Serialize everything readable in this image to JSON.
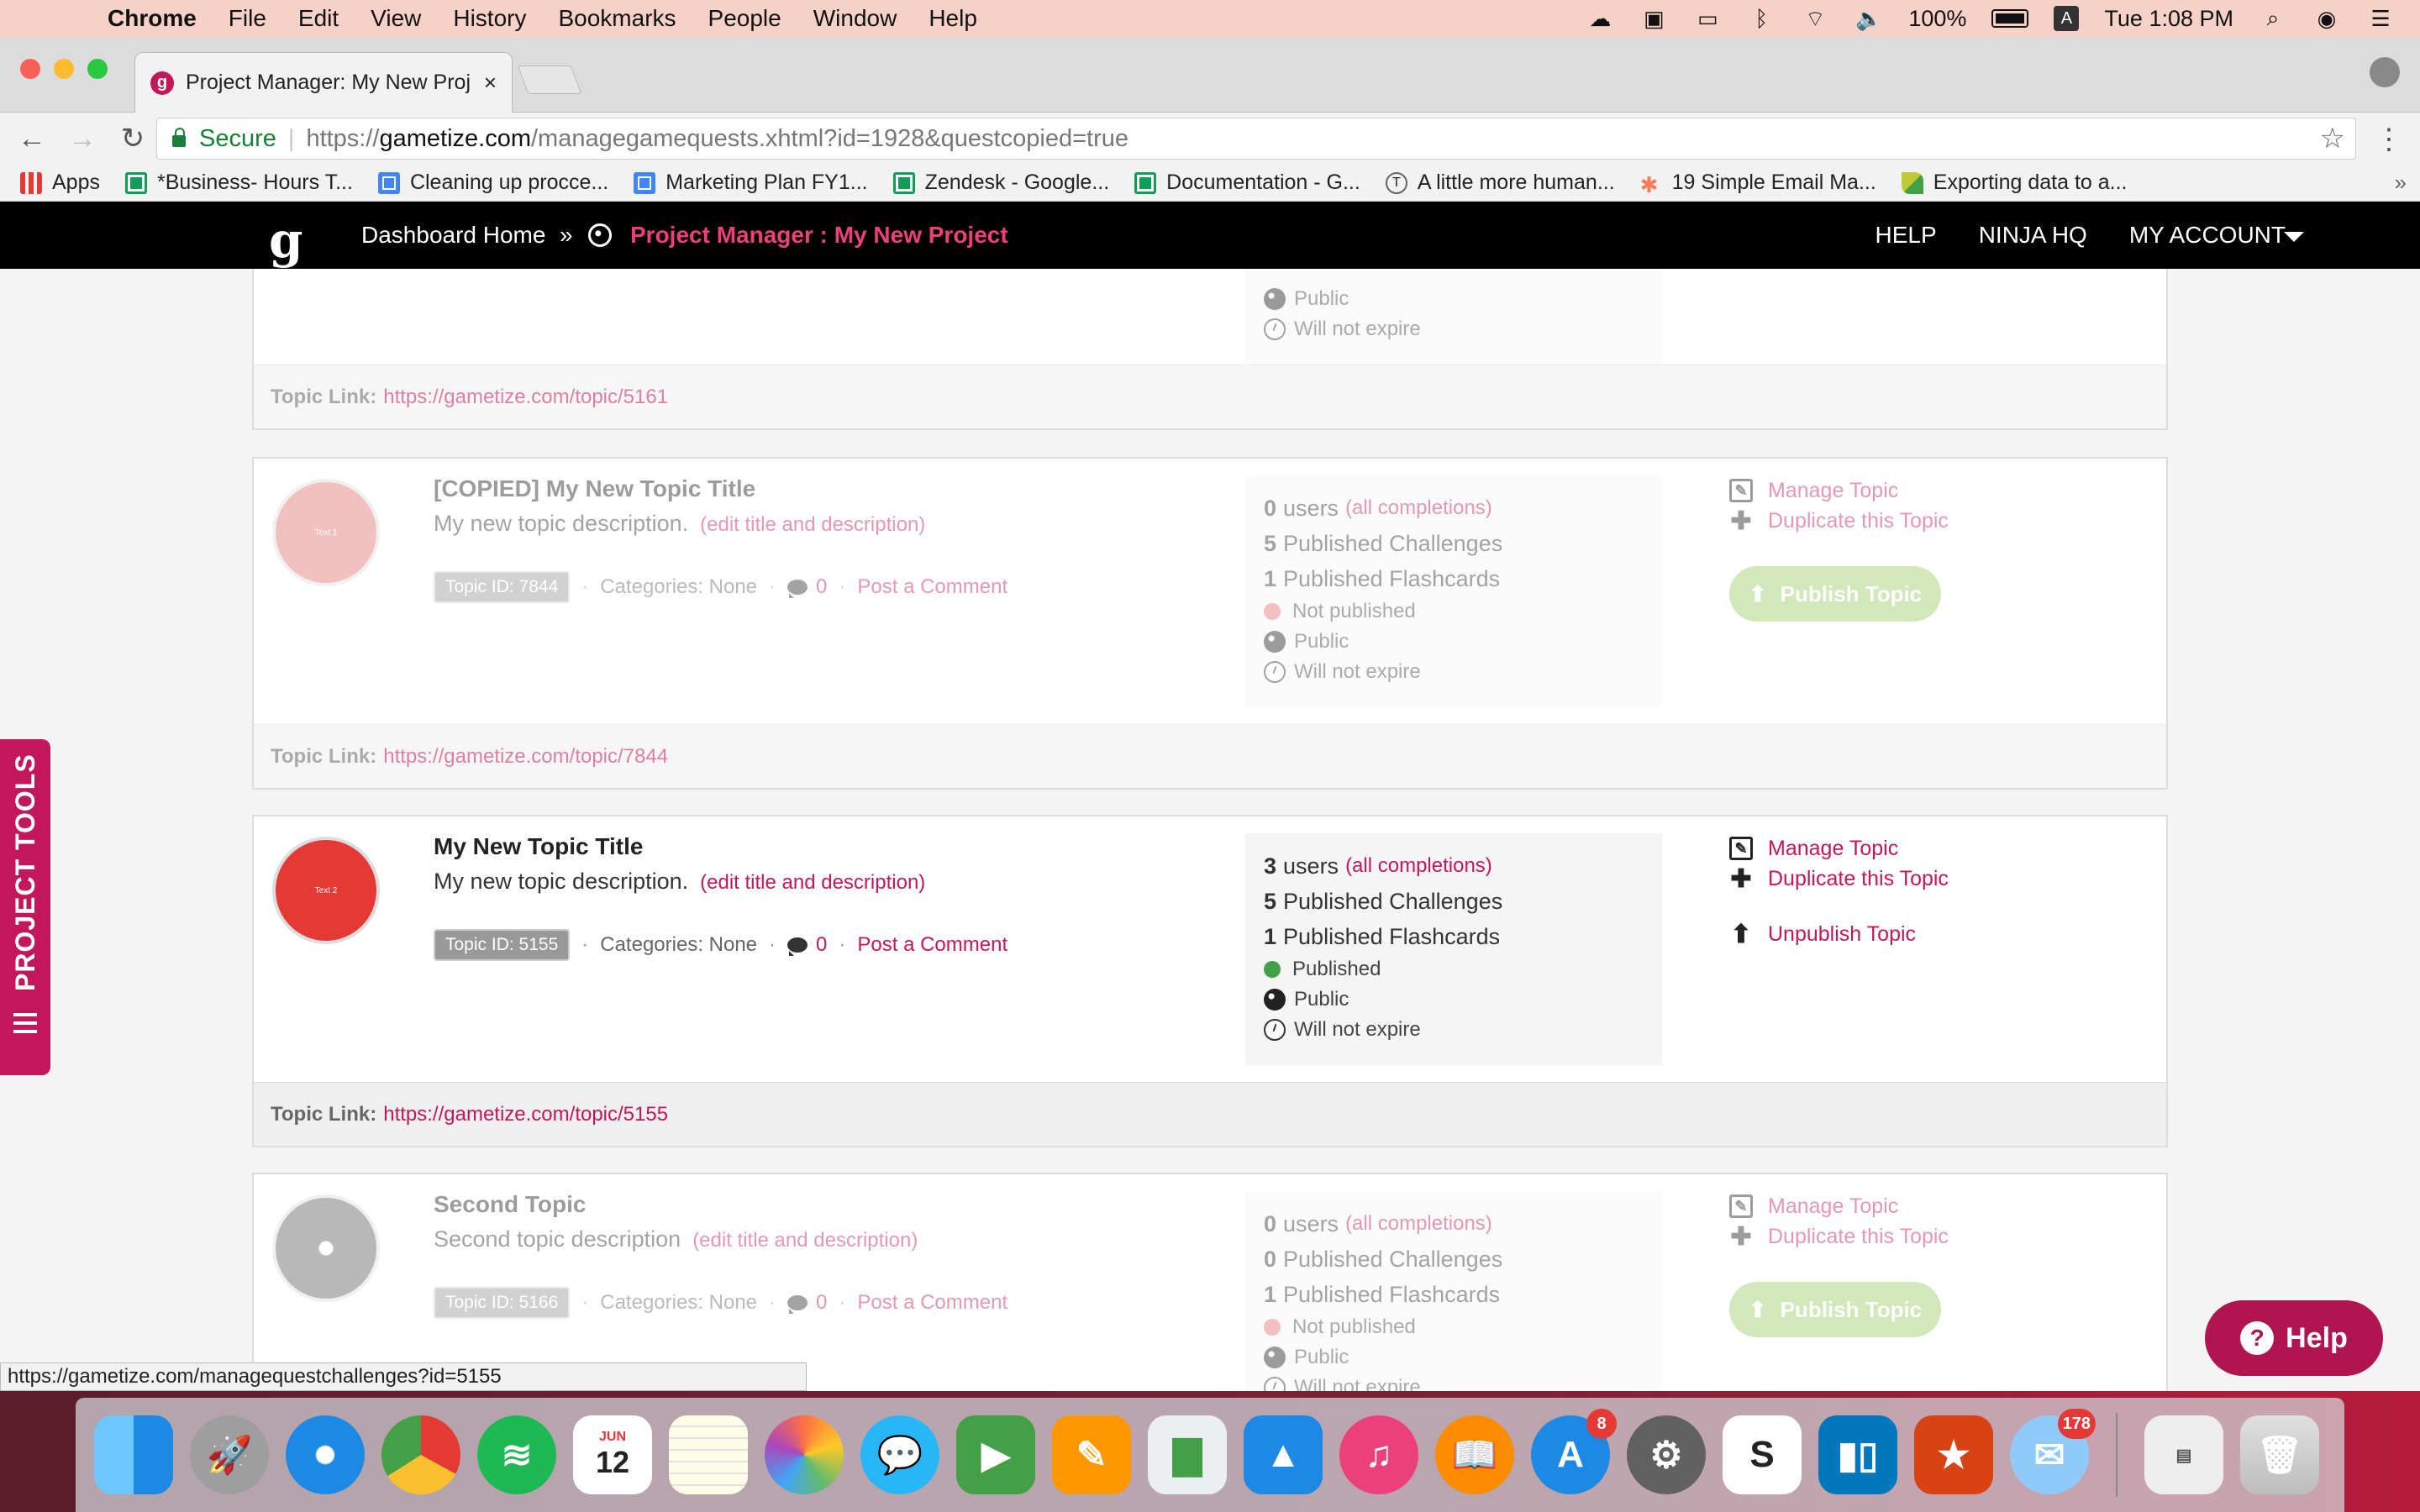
{
  "menubar": {
    "app": "Chrome",
    "items": [
      "File",
      "Edit",
      "View",
      "History",
      "Bookmarks",
      "People",
      "Window",
      "Help"
    ],
    "battery": "100%",
    "user_letter": "A",
    "clock": "Tue 1:08 PM"
  },
  "tab": {
    "title": "Project Manager: My New Proj",
    "favicon": "g"
  },
  "address": {
    "secure_label": "Secure",
    "scheme": "https://",
    "host": "gametize.com",
    "path": "/managegamequests.xhtml?id=1928&questcopied=true"
  },
  "bookmarks": [
    {
      "label": "Apps",
      "icon": "apps"
    },
    {
      "label": "*Business- Hours T...",
      "icon": "sheet"
    },
    {
      "label": "Cleaning up procce...",
      "icon": "doc"
    },
    {
      "label": "Marketing Plan FY1...",
      "icon": "doc"
    },
    {
      "label": "Zendesk - Google...",
      "icon": "sheet"
    },
    {
      "label": "Documentation - G...",
      "icon": "sheet"
    },
    {
      "label": "A little more human...",
      "icon": "t"
    },
    {
      "label": "19 Simple Email Ma...",
      "icon": "hub"
    },
    {
      "label": "Exporting data to a...",
      "icon": "leaf"
    }
  ],
  "header": {
    "logo": "g",
    "home": "Dashboard Home",
    "sep": "»",
    "current": "Project Manager : My New Project",
    "nav": [
      "HELP",
      "NINJA HQ",
      "MY ACCOUNT"
    ]
  },
  "topic_prev": {
    "public": "Public",
    "expiry": "Will not expire",
    "link_label": "Topic Link:",
    "link": "https://gametize.com/topic/5161"
  },
  "topics": [
    {
      "title": "[COPIED] My New Topic Title",
      "desc": "My new topic description.",
      "edit": "(edit title and description)",
      "id_badge": "Topic ID: 7844",
      "categories": "Categories: None",
      "comments": "0",
      "post_comment": "Post a Comment",
      "users_count": "0",
      "users_label": "users",
      "completions": "(all completions)",
      "challenges_count": "5",
      "challenges_label": "Published Challenges",
      "flash_count": "1",
      "flash_label": "Published Flashcards",
      "status": "Not published",
      "status_color": "#e57373",
      "public": "Public",
      "expiry": "Will not expire",
      "manage": "Manage Topic",
      "duplicate": "Duplicate this Topic",
      "publish_action": "Publish Topic",
      "link_label": "Topic Link:",
      "link": "https://gametize.com/topic/7844",
      "image_color": "#e57373",
      "image_text": "Text 1"
    },
    {
      "title": "My New Topic Title",
      "desc": "My new topic description.",
      "edit": "(edit title and description)",
      "id_badge": "Topic ID: 5155",
      "categories": "Categories: None",
      "comments": "0",
      "post_comment": "Post a Comment",
      "users_count": "3",
      "users_label": "users",
      "completions": "(all completions)",
      "challenges_count": "5",
      "challenges_label": "Published Challenges",
      "flash_count": "1",
      "flash_label": "Published Flashcards",
      "status": "Published",
      "status_color": "#43a047",
      "public": "Public",
      "expiry": "Will not expire",
      "manage": "Manage Topic",
      "duplicate": "Duplicate this Topic",
      "publish_action": "Unpublish Topic",
      "link_label": "Topic Link:",
      "link": "https://gametize.com/topic/5155",
      "image_color": "#e53935",
      "image_text": "Text 2"
    },
    {
      "title": "Second Topic",
      "desc": "Second topic description",
      "edit": "(edit title and description)",
      "id_badge": "Topic ID: 5166",
      "categories": "Categories: None",
      "comments": "0",
      "post_comment": "Post a Comment",
      "users_count": "0",
      "users_label": "users",
      "completions": "(all completions)",
      "challenges_count": "0",
      "challenges_label": "Published Challenges",
      "flash_count": "1",
      "flash_label": "Published Flashcards",
      "status": "Not published",
      "status_color": "#e57373",
      "public": "Public",
      "expiry": "Will not expire",
      "manage": "Manage Topic",
      "duplicate": "Duplicate this Topic",
      "publish_action": "Publish Topic",
      "image_color": "#616161",
      "image_text": ""
    }
  ],
  "project_tools": "PROJECT TOOLS",
  "help_button": "Help",
  "status_url": "https://gametize.com/managequestchallenges?id=5155",
  "dock": {
    "apps": [
      "Finder",
      "Launchpad",
      "Safari",
      "Chrome",
      "Spotify",
      "Calendar",
      "Notes",
      "Photos",
      "Messages",
      "FaceTime",
      "Pages",
      "Numbers",
      "Keynote",
      "iTunes",
      "iBooks",
      "App Store",
      "System Preferences",
      "Slack",
      "Trello",
      "Wunderlist",
      "Airmail",
      "Files",
      "Trash"
    ],
    "calendar_month": "JUN",
    "calendar_day": "12",
    "appstore_badge": "8",
    "airmail_badge": "178"
  }
}
